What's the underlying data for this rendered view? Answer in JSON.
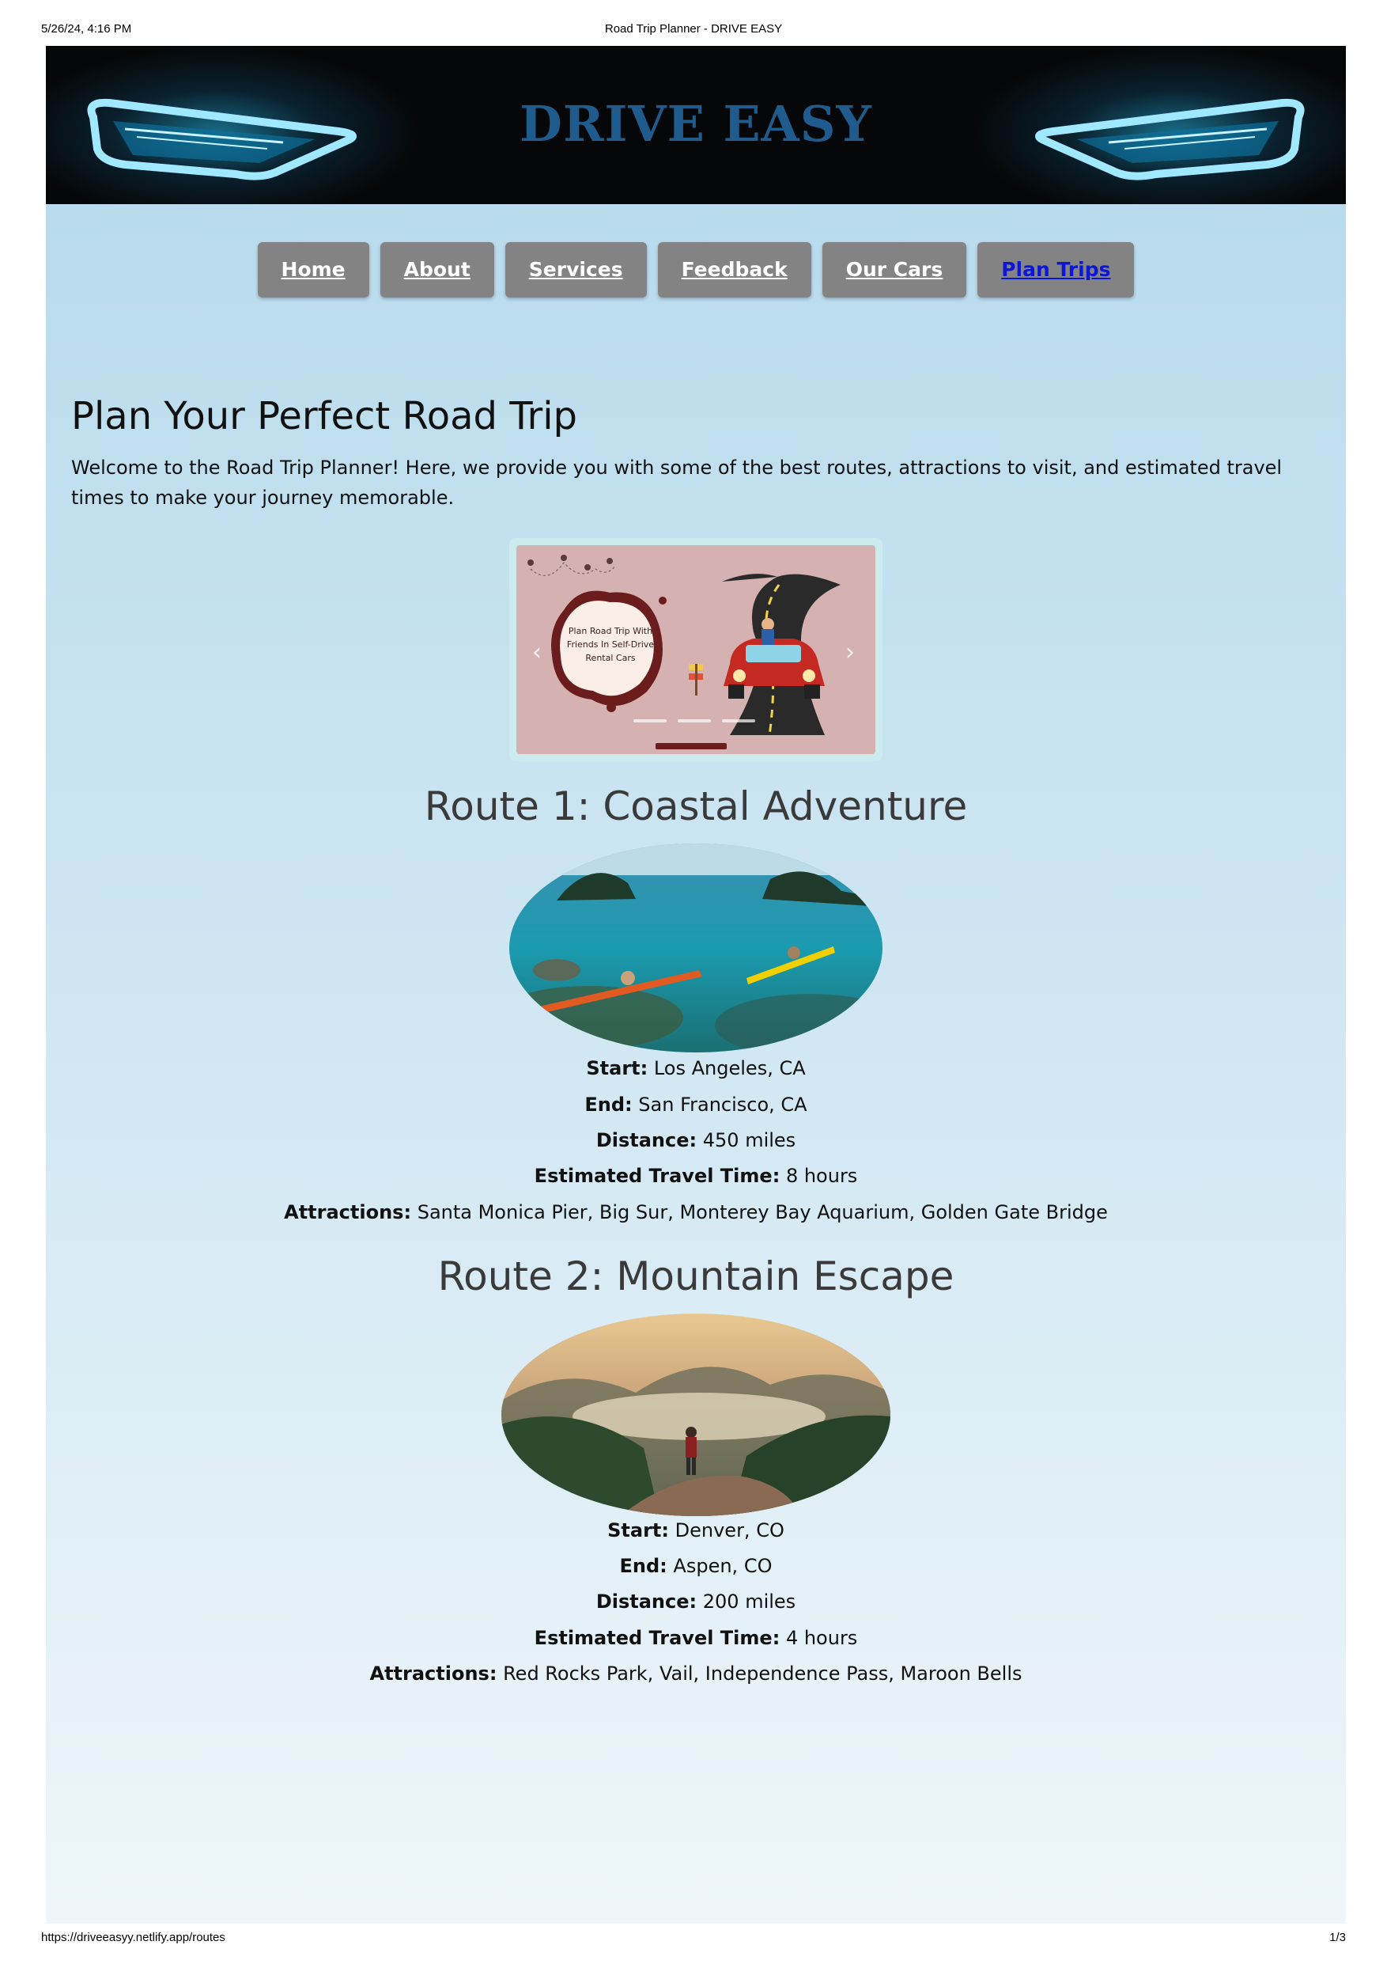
{
  "print_header": {
    "datetime": "5/26/24, 4:16 PM",
    "title": "Road Trip Planner - DRIVE EASY"
  },
  "print_footer": {
    "url": "https://driveeasyy.netlify.app/routes",
    "page": "1/3"
  },
  "banner": {
    "title": "DRIVE EASY"
  },
  "nav": {
    "items": [
      {
        "label": "Home",
        "active": false
      },
      {
        "label": "About",
        "active": false
      },
      {
        "label": "Services",
        "active": false
      },
      {
        "label": "Feedback",
        "active": false
      },
      {
        "label": "Our Cars",
        "active": false
      },
      {
        "label": "Plan Trips",
        "active": true
      }
    ]
  },
  "intro": {
    "heading": "Plan Your Perfect Road Trip",
    "text": "Welcome to the Road Trip Planner! Here, we provide you with some of the best routes, attractions to visit, and estimated travel times to make your journey memorable."
  },
  "carousel": {
    "card_text": "Plan Road Trip With Friends In Self-Drive Rental Cars",
    "prev_icon": "chevron-left-icon",
    "next_icon": "chevron-right-icon"
  },
  "routes": [
    {
      "title": "Route 1: Coastal Adventure",
      "image": "coastal-kayaking-image",
      "start_label": "Start:",
      "start": "Los Angeles, CA",
      "end_label": "End:",
      "end": "San Francisco, CA",
      "distance_label": "Distance:",
      "distance": "450 miles",
      "time_label": "Estimated Travel Time:",
      "time": "8 hours",
      "attractions_label": "Attractions:",
      "attractions": "Santa Monica Pier, Big Sur, Monterey Bay Aquarium, Golden Gate Bridge"
    },
    {
      "title": "Route 2: Mountain Escape",
      "image": "mountain-hiker-image",
      "start_label": "Start:",
      "start": "Denver, CO",
      "end_label": "End:",
      "end": "Aspen, CO",
      "distance_label": "Distance:",
      "distance": "200 miles",
      "time_label": "Estimated Travel Time:",
      "time": "4 hours",
      "attractions_label": "Attractions:",
      "attractions": "Red Rocks Park, Vail, Independence Pass, Maroon Bells"
    }
  ]
}
